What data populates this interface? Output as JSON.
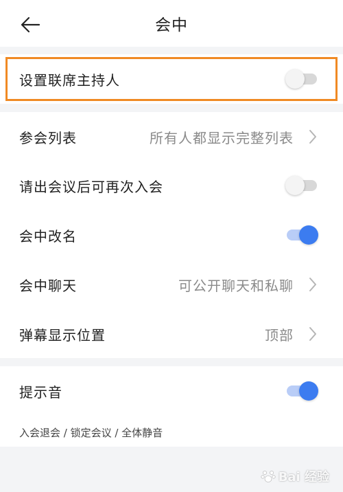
{
  "header": {
    "title": "会中",
    "back_icon": "arrow-left-icon"
  },
  "section1": {
    "host_label": "设置联席主持人",
    "host_toggle": false
  },
  "section2": {
    "participant_list_label": "参会列表",
    "participant_list_value": "所有人都显示完整列表",
    "rejoin_label": "请出会议后可再次入会",
    "rejoin_toggle": false,
    "rename_label": "会中改名",
    "rename_toggle": true,
    "chat_label": "会中聊天",
    "chat_value": "可公开聊天和私聊",
    "danmaku_label": "弹幕显示位置",
    "danmaku_value": "顶部"
  },
  "section3": {
    "sound_label": "提示音",
    "sound_toggle": true,
    "sound_subtext": "入会退会 / 锁定会议 / 全体静音"
  },
  "watermark": {
    "text": "Bai 经验"
  },
  "colors": {
    "accent": "#3c7cf0",
    "highlight": "#f08a24",
    "background": "#f3f4f6"
  }
}
